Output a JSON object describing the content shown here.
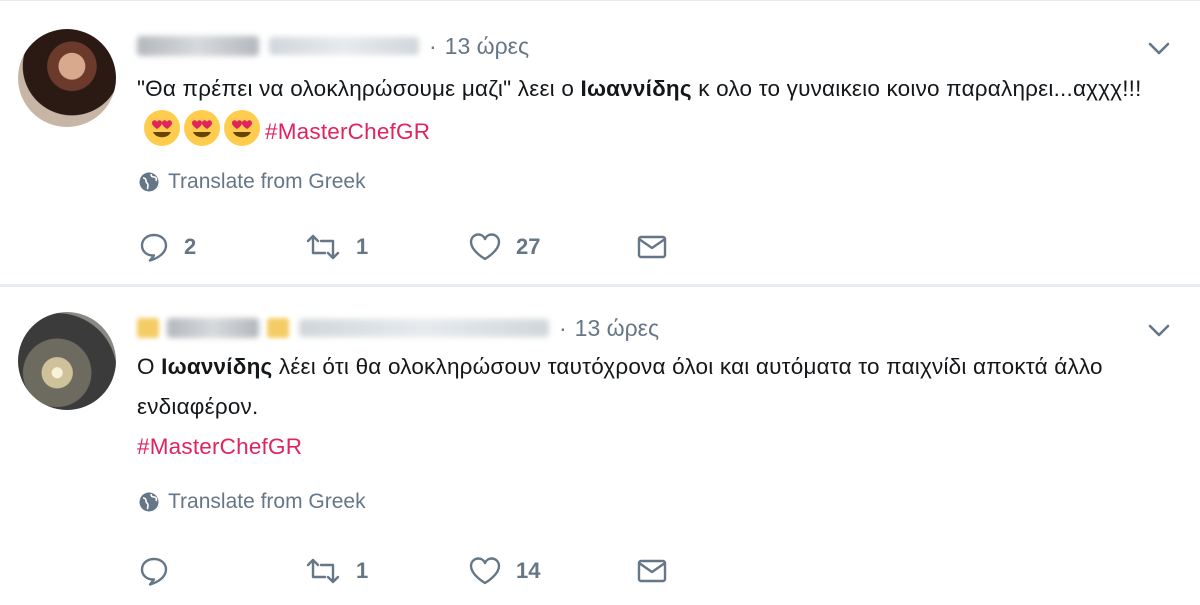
{
  "tweets": [
    {
      "time": "13 ώρες",
      "text_parts": [
        "\"Θα πρέπει να ολοκληρώσουμε μαζι\" λεει ο ",
        "Ιωαννίδης",
        " κ ολο το γυναικειο κοινο παραληρει...αχχχ!!! "
      ],
      "hashtag": "#MasterChefGR",
      "translate": "Translate from Greek",
      "replies": "2",
      "retweets": "1",
      "likes": "27"
    },
    {
      "time": "13 ώρες",
      "text_parts": [
        "Ο ",
        "Ιωαννίδης",
        " λέει ότι θα ολοκληρώσουν ταυτόχρονα όλοι και αυτόματα το παιχνίδι αποκτά άλλο ενδιαφέρον."
      ],
      "hashtag": "#MasterChefGR",
      "translate": "Translate from Greek",
      "replies": "",
      "retweets": "1",
      "likes": "14"
    }
  ],
  "icons": {
    "reply": "reply-icon",
    "retweet": "retweet-icon",
    "like": "heart-icon",
    "dm": "envelope-icon",
    "globe": "globe-icon",
    "caret": "chevron-down-icon",
    "emoji": "heart-eyes-emoji"
  },
  "colors": {
    "hashtag": "#e0245e",
    "secondary": "#657786"
  }
}
